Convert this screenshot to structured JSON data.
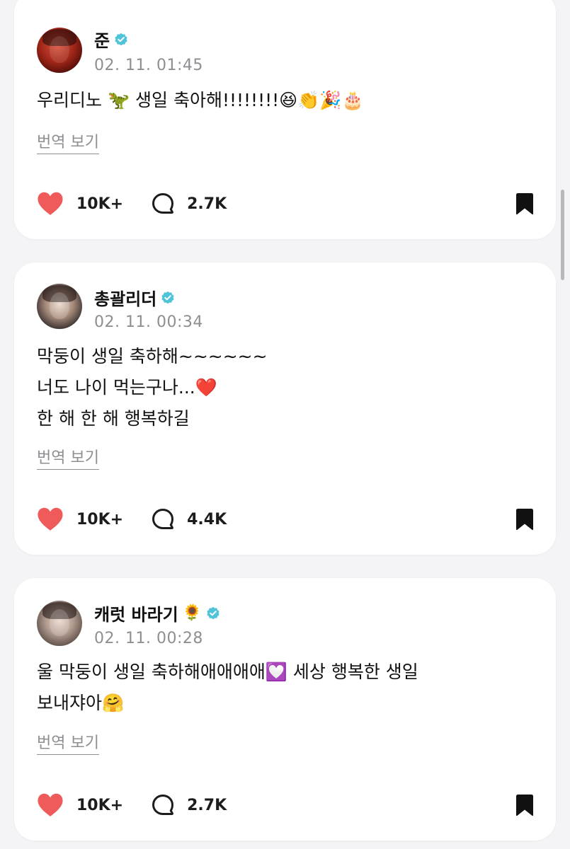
{
  "posts": [
    {
      "author": "준",
      "verified": true,
      "timestamp": "02. 11. 01:45",
      "lines": [
        "우리디노 🦖 생일 축아해!!!!!!!!😆👏🎉🎂"
      ],
      "translate_label": "번역 보기",
      "likes": "10K+",
      "comments": "2.7K"
    },
    {
      "author": "총괄리더",
      "verified": true,
      "timestamp": "02. 11. 00:34",
      "lines": [
        "막둥이 생일 축하해~~~~~~",
        "너도 나이 먹는구나...❤️",
        "한 해 한 해 행복하길"
      ],
      "translate_label": "번역 보기",
      "likes": "10K+",
      "comments": "4.4K"
    },
    {
      "author": "캐럿 바라기",
      "author_emoji": "🌻",
      "verified": true,
      "timestamp": "02. 11. 00:28",
      "lines": [
        "울 막둥이 생일 축하해애애애애💟 세상 행복한 생일",
        "보내쟈아🤗"
      ],
      "translate_label": "번역 보기",
      "likes": "10K+",
      "comments": "2.7K"
    }
  ],
  "icons": {
    "like": "heart-icon",
    "comment": "comment-bubble-icon",
    "bookmark": "bookmark-icon",
    "verified": "verified-badge-icon"
  },
  "colors": {
    "heart": "#ef5a5a",
    "verified": "#4fc4d9",
    "muted_text": "#8e8e93",
    "background": "#f4f4f6"
  }
}
